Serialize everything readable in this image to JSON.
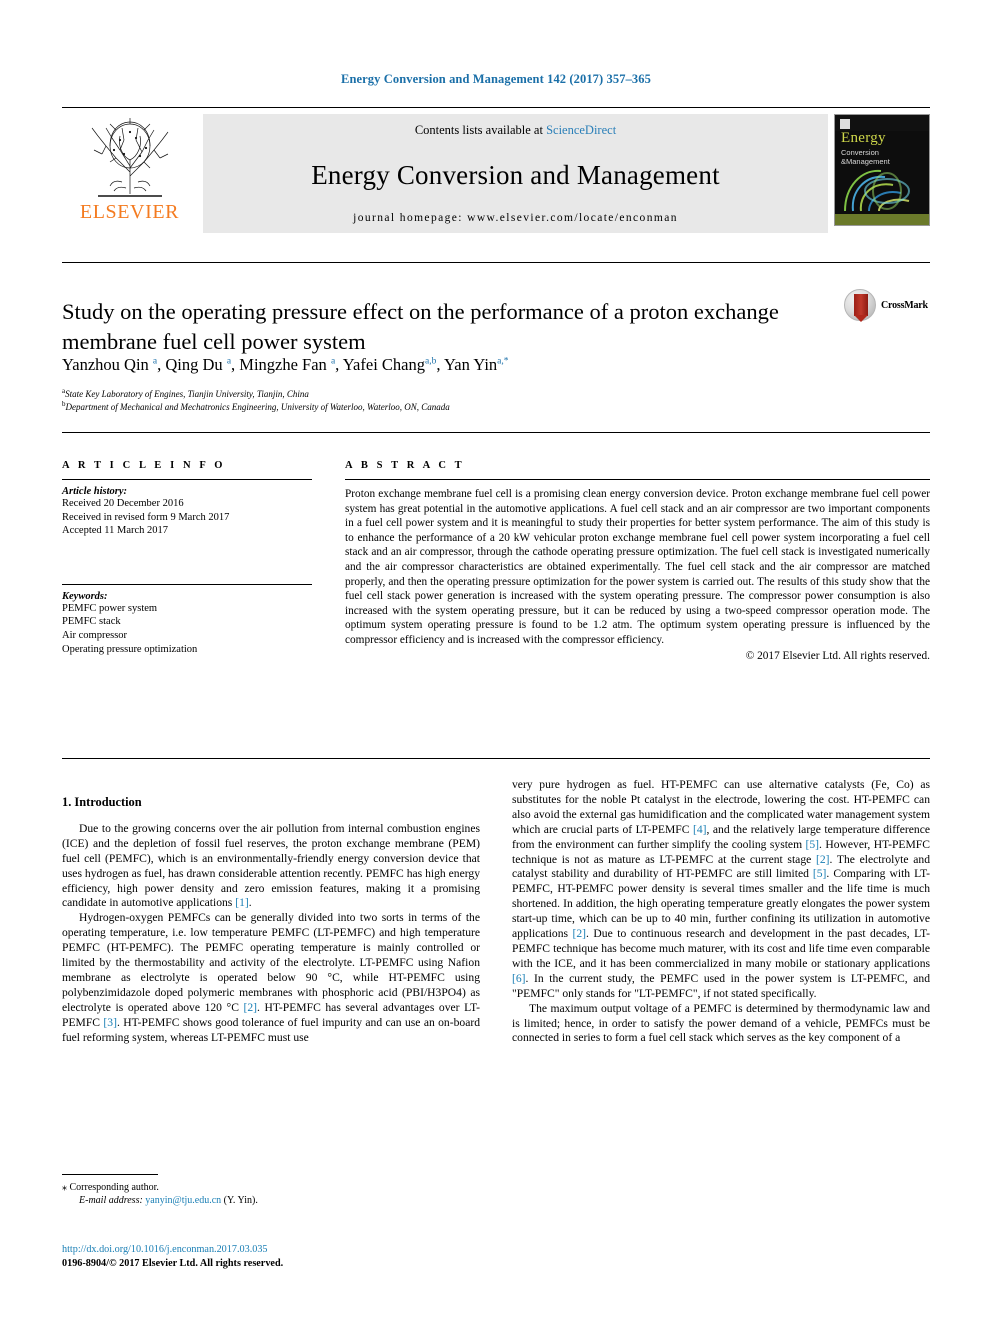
{
  "running_head": "Energy Conversion and Management 142 (2017) 357–365",
  "masthead": {
    "publisher": "ELSEVIER",
    "contents_prefix": "Contents lists available at ",
    "contents_link": "ScienceDirect",
    "journal_title": "Energy Conversion and Management",
    "homepage": "journal homepage: www.elsevier.com/locate/enconman",
    "cover": {
      "title": "Energy",
      "subtitle_line1": "Conversion",
      "subtitle_line2": "&Management"
    }
  },
  "article": {
    "title": "Study on the operating pressure effect on the performance of a proton exchange membrane fuel cell power system",
    "crossmark_label": "CrossMark",
    "authors_html": "Yanzhou Qin <sup>a</sup>, Qing Du <sup>a</sup>, Mingzhe Fan <sup>a</sup>, Yafei Chang<sup>a,b</sup>, Yan Yin<sup>a,*</sup>",
    "affiliation_a": "State Key Laboratory of Engines, Tianjin University, Tianjin, China",
    "affiliation_b": "Department of Mechanical and Mechatronics Engineering, University of Waterloo, Waterloo, ON, Canada",
    "affiliation_a_marker": "a",
    "affiliation_b_marker": "b"
  },
  "article_info": {
    "heading": "A R T I C L E   I N F O",
    "history_label": "Article history:",
    "history": [
      "Received 20 December 2016",
      "Received in revised form 9 March 2017",
      "Accepted 11 March 2017"
    ],
    "keywords_label": "Keywords:",
    "keywords": [
      "PEMFC power system",
      "PEMFC stack",
      "Air compressor",
      "Operating pressure optimization"
    ]
  },
  "abstract": {
    "heading": "A B S T R A C T",
    "text": "Proton exchange membrane fuel cell is a promising clean energy conversion device. Proton exchange membrane fuel cell power system has great potential in the automotive applications. A fuel cell stack and an air compressor are two important components in a fuel cell power system and it is meaningful to study their properties for better system performance. The aim of this study is to enhance the performance of a 20 kW vehicular proton exchange membrane fuel cell power system incorporating a fuel cell stack and an air compressor, through the cathode operating pressure optimization. The fuel cell stack is investigated numerically and the air compressor characteristics are obtained experimentally. The fuel cell stack and the air compressor are matched properly, and then the operating pressure optimization for the power system is carried out. The results of this study show that the fuel cell stack power generation is increased with the system operating pressure. The compressor power consumption is also increased with the system operating pressure, but it can be reduced by using a two-speed compressor operation mode. The optimum system operating pressure is found to be 1.2 atm. The optimum system operating pressure is influenced by the compressor efficiency and is increased with the compressor efficiency.",
    "copyright": "© 2017 Elsevier Ltd. All rights reserved."
  },
  "introduction": {
    "heading": "1. Introduction",
    "left_paragraphs": [
      "Due to the growing concerns over the air pollution from internal combustion engines (ICE) and the depletion of fossil fuel reserves, the proton exchange membrane (PEM) fuel cell (PEMFC), which is an environmentally-friendly energy conversion device that uses hydrogen as fuel, has drawn considerable attention recently. PEMFC has high energy efficiency, high power density and zero emission features, making it a promising candidate in automotive applications [1].",
      "Hydrogen-oxygen PEMFCs can be generally divided into two sorts in terms of the operating temperature, i.e. low temperature PEMFC (LT-PEMFC) and high temperature PEMFC (HT-PEMFC). The PEMFC operating temperature is mainly controlled or limited by the thermostability and activity of the electrolyte. LT-PEMFC using Nafion membrane as electrolyte is operated below 90 °C, while HT-PEMFC using polybenzimidazole doped polymeric membranes with phosphoric acid (PBI/H3PO4) as electrolyte is operated above 120 °C [2]. HT-PEMFC has several advantages over LT-PEMFC [3]. HT-PEMFC shows good tolerance of fuel impurity and can use an on-board fuel reforming system, whereas LT-PEMFC must use"
    ],
    "right_paragraphs": [
      "very pure hydrogen as fuel. HT-PEMFC can use alternative catalysts (Fe, Co) as substitutes for the noble Pt catalyst in the electrode, lowering the cost. HT-PEMFC can also avoid the external gas humidification and the complicated water management system which are crucial parts of LT-PEMFC [4], and the relatively large temperature difference from the environment can further simplify the cooling system [5]. However, HT-PEMFC technique is not as mature as LT-PEMFC at the current stage [2]. The electrolyte and catalyst stability and durability of HT-PEMFC are still limited [5]. Comparing with LT-PEMFC, HT-PEMFC power density is several times smaller and the life time is much shortened. In addition, the high operating temperature greatly elongates the power system start-up time, which can be up to 40 min, further confining its utilization in automotive applications [2]. Due to continuous research and development in the past decades, LT-PEMFC technique has become much maturer, with its cost and life time even comparable with the ICE, and it has been commercialized in many mobile or stationary applications [6]. In the current study, the PEMFC used in the power system is LT-PEMFC, and \"PEMFC\" only stands for \"LT-PEMFC\", if not stated specifically.",
      "The maximum output voltage of a PEMFC is determined by thermodynamic law and is limited; hence, in order to satisfy the power demand of a vehicle, PEMFCs must be connected in series to form a fuel cell stack which serves as the key component of a"
    ]
  },
  "footer": {
    "corresponding_marker": "⁎",
    "corresponding_text": "Corresponding author.",
    "email_label": "E-mail address:",
    "email": "yanyin@tju.edu.cn",
    "email_suffix": "(Y. Yin).",
    "doi": "http://dx.doi.org/10.1016/j.enconman.2017.03.035",
    "issn_line": "0196-8904/© 2017 Elsevier Ltd. All rights reserved."
  },
  "colors": {
    "link_blue": "#1a7fb5",
    "elsevier_orange": "#f47b20",
    "band_gray": "#e8e8e8"
  }
}
